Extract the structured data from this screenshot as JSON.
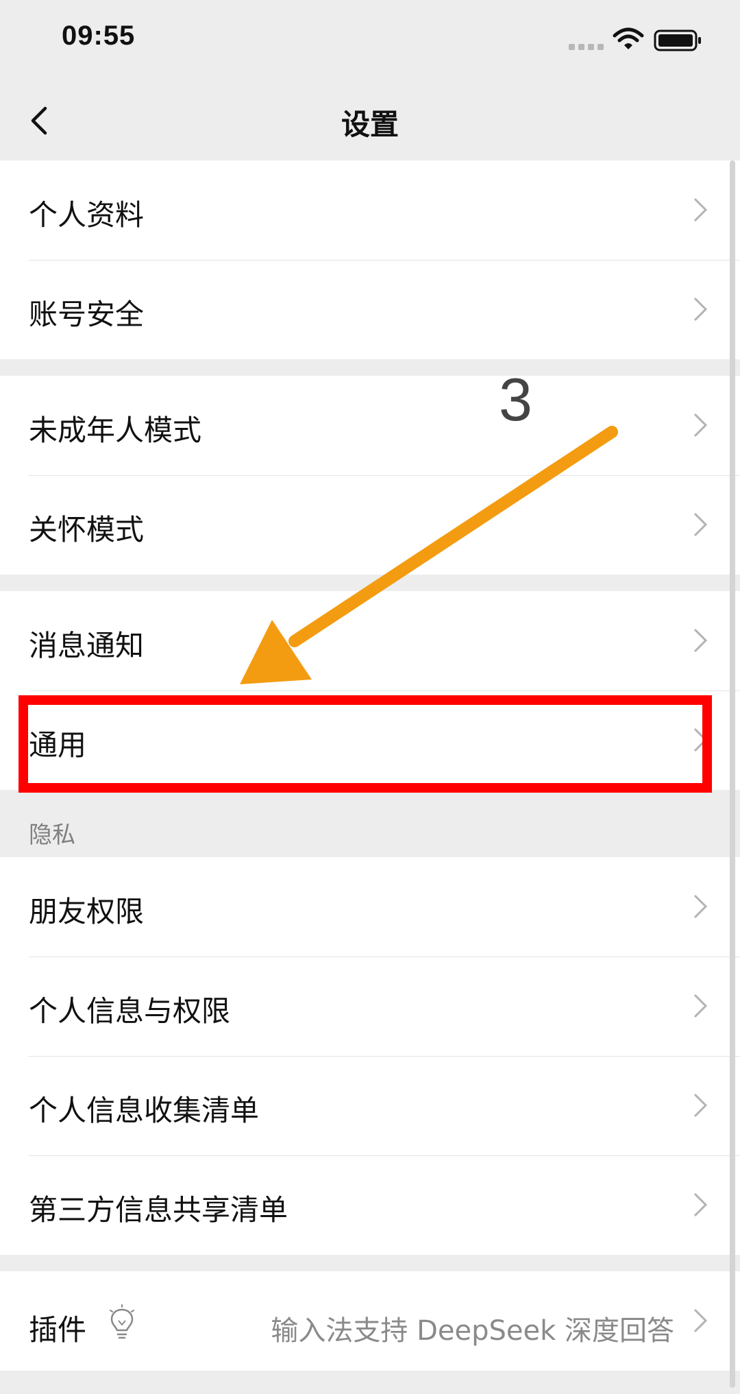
{
  "status_bar": {
    "time": "09:55",
    "icons": [
      "signal-dots-icon",
      "wifi-icon",
      "battery-icon"
    ]
  },
  "nav": {
    "title": "设置",
    "back_icon": "chevron-left-icon"
  },
  "groups": [
    {
      "items": [
        {
          "label": "个人资料"
        },
        {
          "label": "账号安全"
        }
      ]
    },
    {
      "items": [
        {
          "label": "未成年人模式"
        },
        {
          "label": "关怀模式"
        }
      ]
    },
    {
      "items": [
        {
          "label": "消息通知"
        },
        {
          "label": "通用",
          "highlighted": true
        }
      ]
    },
    {
      "header": "隐私",
      "items": [
        {
          "label": "朋友权限"
        },
        {
          "label": "个人信息与权限"
        },
        {
          "label": "个人信息收集清单"
        },
        {
          "label": "第三方信息共享清单"
        }
      ]
    },
    {
      "items": [
        {
          "label": "插件",
          "icon": "lightbulb-icon",
          "value": "输入法支持 DeepSeek 深度回答"
        }
      ]
    }
  ],
  "annotation": {
    "step_number": "3",
    "arrow_color": "#f39c11",
    "box_color": "#ff0000"
  }
}
